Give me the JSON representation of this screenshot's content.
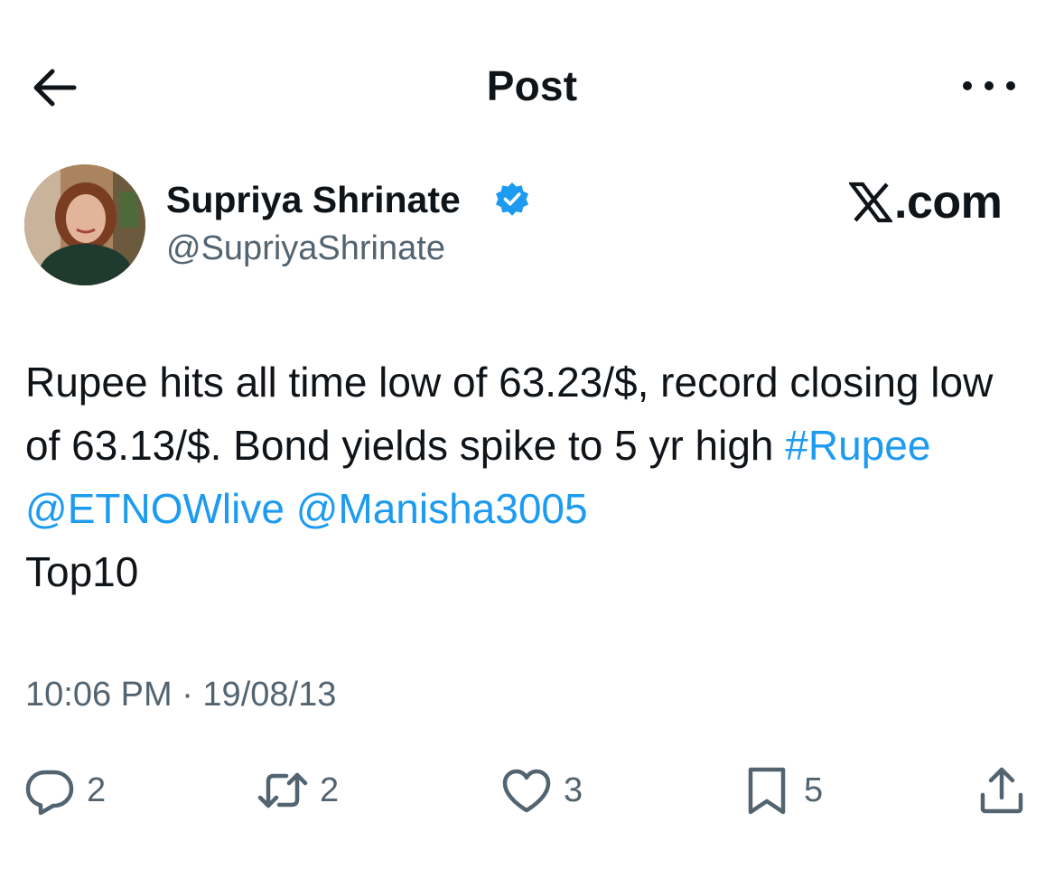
{
  "header": {
    "title": "Post",
    "back_icon": "arrow-left-icon",
    "more_icon": "more-horizontal-icon"
  },
  "author": {
    "name": "Supriya Shrinate",
    "handle": "@SupriyaShrinate",
    "verified": true,
    "verified_color": "#1d9bf0"
  },
  "brand": {
    "mark_icon": "x-logo-icon",
    "text": ".com"
  },
  "post": {
    "text_plain_1": "Rupee hits all time low of  63.23/$, record closing low of 63.13/$. Bond yields spike to 5 yr high ",
    "hashtag": "#Rupee",
    "mention_1": "@ETNOWlive",
    "mention_2": "@Manisha3005",
    "text_plain_2": "Top10",
    "link_color": "#1d9bf0"
  },
  "timestamp": "10:06 PM · 19/08/13",
  "actions": {
    "reply": {
      "icon": "reply-icon",
      "count": "2"
    },
    "repost": {
      "icon": "repost-icon",
      "count": "2"
    },
    "like": {
      "icon": "heart-icon",
      "count": "3"
    },
    "bookmark": {
      "icon": "bookmark-icon",
      "count": "5"
    },
    "share": {
      "icon": "share-icon"
    }
  }
}
